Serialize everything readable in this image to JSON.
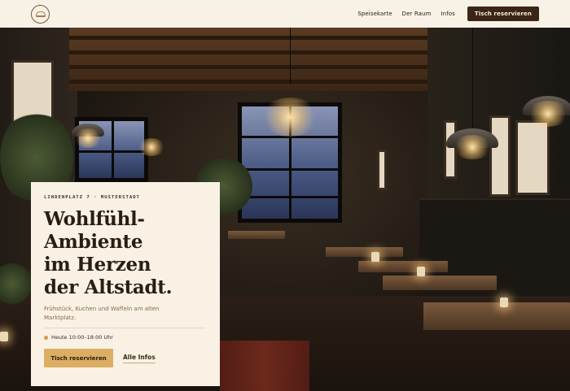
{
  "header": {
    "nav": [
      "Speisekarte",
      "Der Raum",
      "Infos"
    ],
    "cta": "Tisch reservieren"
  },
  "hero": {
    "eyebrow": "LINDENPLATZ 7 · MUSTERSTADT",
    "headline": [
      "Wohlfühl-",
      "Ambiente",
      "im Herzen",
      "der Altstadt."
    ],
    "subline": "Frühstück, Kuchen und Waffeln am alten Marktplatz.",
    "hours": "Heute 10:00–18:00 Uhr",
    "primary_button": "Tisch reservieren",
    "secondary_link": "Alle Infos"
  },
  "colors": {
    "header_bg": "#f7f1e6",
    "cta_bg": "#3a2516",
    "card_bg": "#f8f1e4",
    "button_gold": "#dcae62",
    "status_dot": "#d49a45"
  },
  "icons": {
    "logo": "coffee-cup-logo-icon",
    "hours_dot": "open-status-dot-icon"
  }
}
